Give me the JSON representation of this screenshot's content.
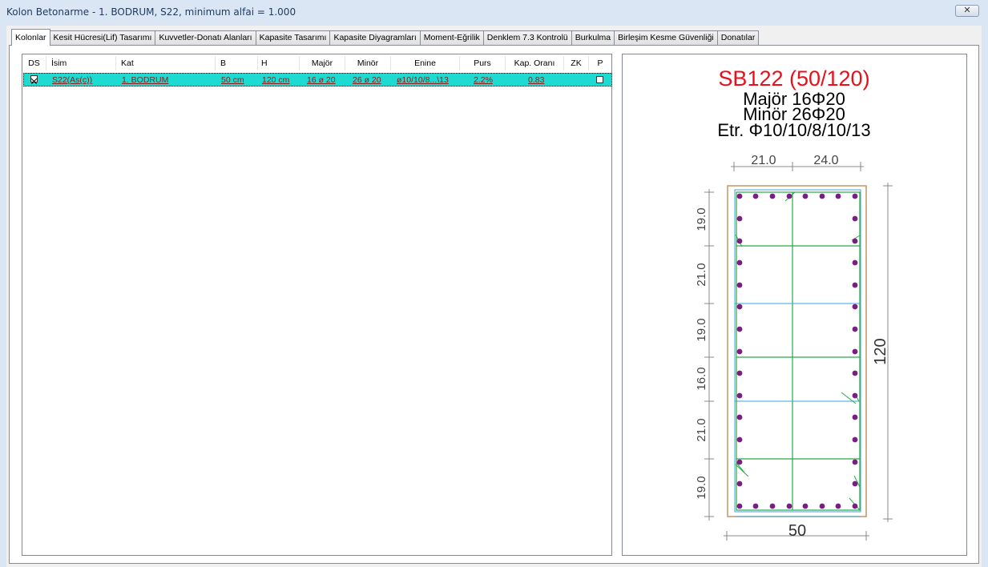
{
  "window": {
    "title": "Kolon Betonarme - 1. BODRUM, S22, minimum alfai = 1.000",
    "close_glyph": "✕"
  },
  "tabs": [
    {
      "label": "Kolonlar",
      "active": true
    },
    {
      "label": "Kesit Hücresi(Lif) Tasarımı",
      "active": false
    },
    {
      "label": "Kuvvetler-Donatı Alanları",
      "active": false
    },
    {
      "label": "Kapasite Tasarımı",
      "active": false
    },
    {
      "label": "Kapasite Diyagramları",
      "active": false
    },
    {
      "label": "Moment-Eğrilik",
      "active": false
    },
    {
      "label": "Denklem 7.3 Kontrolü",
      "active": false
    },
    {
      "label": "Burkulma",
      "active": false
    },
    {
      "label": "Birleşim Kesme Güvenliği",
      "active": false
    },
    {
      "label": "Donatılar",
      "active": false
    }
  ],
  "table": {
    "columns": [
      "DS",
      "İsim",
      "Kat",
      "B",
      "H",
      "Majör",
      "Minör",
      "Enine",
      "Purs",
      "Kap. Oranı",
      "ZK",
      "P"
    ],
    "rows": [
      {
        "ds_checked": true,
        "isim": "S22(As(c))",
        "kat": "1. BODRUM",
        "b": "50 cm",
        "h": "120 cm",
        "major": "16 ø 20",
        "minor": "26 ø 20",
        "enine": "ø10/10/8...\\13",
        "purs": "2.2%",
        "kap_orani": "0.83",
        "zk": "",
        "p_checked": false
      }
    ],
    "row_highlight_color": "#1ddbd0",
    "row_text_color": "#8b1a1a"
  },
  "section_drawing": {
    "title": "SB122 (50/120)",
    "title_color": "#e8101a",
    "line_major": "Majör 16Φ20",
    "line_minor": "Minör 26Φ20",
    "line_etr": "Etr. Φ10/10/8/10/13",
    "top_dims": [
      "21.0",
      "24.0"
    ],
    "left_dims": [
      "19.0",
      "21.0",
      "19.0",
      "16.0",
      "21.0",
      "19.0"
    ],
    "width_label": "50",
    "height_label": "120",
    "section_outline_color": "#c89462",
    "stirrup_color": "#2aa84a",
    "tie_color": "#3aa7d6",
    "rebar_color": "#7a1e84"
  }
}
